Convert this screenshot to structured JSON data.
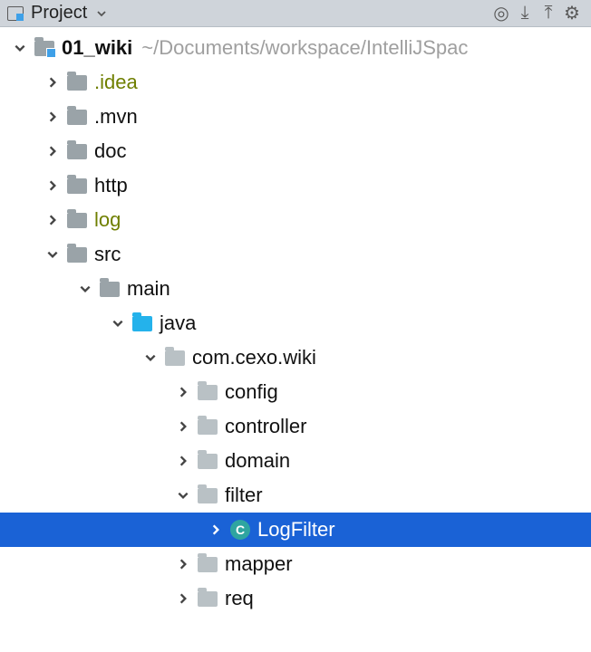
{
  "toolbar": {
    "title": "Project"
  },
  "root": {
    "name": "01_wiki",
    "path": "~/Documents/workspace/IntelliJSpac"
  },
  "tree": [
    {
      "id": "idea",
      "label": ".idea",
      "depth": 1,
      "expanded": false,
      "kind": "folder",
      "olive": true
    },
    {
      "id": "mvn",
      "label": ".mvn",
      "depth": 1,
      "expanded": false,
      "kind": "folder",
      "olive": false
    },
    {
      "id": "doc",
      "label": "doc",
      "depth": 1,
      "expanded": false,
      "kind": "folder",
      "olive": false
    },
    {
      "id": "http",
      "label": "http",
      "depth": 1,
      "expanded": false,
      "kind": "folder",
      "olive": false
    },
    {
      "id": "log",
      "label": "log",
      "depth": 1,
      "expanded": false,
      "kind": "folder",
      "olive": true
    },
    {
      "id": "src",
      "label": "src",
      "depth": 1,
      "expanded": true,
      "kind": "folder",
      "olive": false
    },
    {
      "id": "main",
      "label": "main",
      "depth": 2,
      "expanded": true,
      "kind": "folder",
      "olive": false
    },
    {
      "id": "java",
      "label": "java",
      "depth": 3,
      "expanded": true,
      "kind": "source",
      "olive": false
    },
    {
      "id": "pkg",
      "label": "com.cexo.wiki",
      "depth": 4,
      "expanded": true,
      "kind": "package",
      "olive": false
    },
    {
      "id": "config",
      "label": "config",
      "depth": 5,
      "expanded": false,
      "kind": "package",
      "olive": false
    },
    {
      "id": "controller",
      "label": "controller",
      "depth": 5,
      "expanded": false,
      "kind": "package",
      "olive": false
    },
    {
      "id": "domain",
      "label": "domain",
      "depth": 5,
      "expanded": false,
      "kind": "package",
      "olive": false
    },
    {
      "id": "filter",
      "label": "filter",
      "depth": 5,
      "expanded": true,
      "kind": "package",
      "olive": false
    },
    {
      "id": "logfilter",
      "label": "LogFilter",
      "depth": 6,
      "expanded": false,
      "kind": "class",
      "olive": false,
      "selected": true
    },
    {
      "id": "mapper",
      "label": "mapper",
      "depth": 5,
      "expanded": false,
      "kind": "package",
      "olive": false
    },
    {
      "id": "req",
      "label": "req",
      "depth": 5,
      "expanded": false,
      "kind": "package",
      "olive": false
    }
  ]
}
